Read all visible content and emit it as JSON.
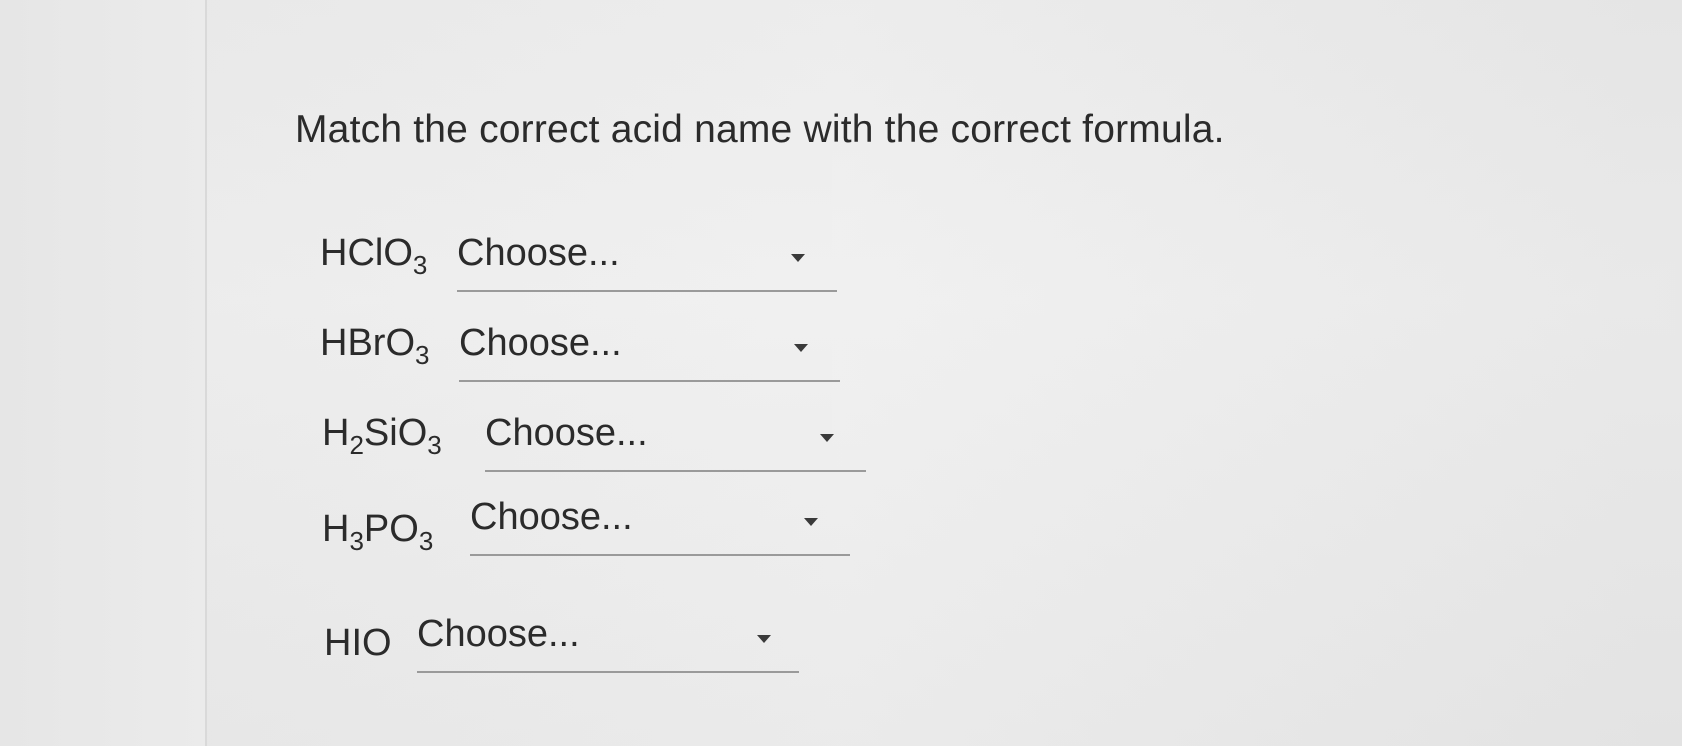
{
  "question": "Match the correct acid name with the correct formula.",
  "rows": [
    {
      "formula": {
        "parts": [
          {
            "t": "HClO"
          },
          {
            "s": "3"
          }
        ]
      },
      "select_value": "Choose..."
    },
    {
      "formula": {
        "parts": [
          {
            "t": "HBrO"
          },
          {
            "s": "3"
          }
        ]
      },
      "select_value": "Choose..."
    },
    {
      "formula": {
        "parts": [
          {
            "t": "H"
          },
          {
            "s": "2"
          },
          {
            "t": "SiO"
          },
          {
            "s": "3"
          }
        ]
      },
      "select_value": "Choose..."
    },
    {
      "formula": {
        "parts": [
          {
            "t": "H"
          },
          {
            "s": "3"
          },
          {
            "t": "PO"
          },
          {
            "s": "3"
          }
        ]
      },
      "select_value": "Choose..."
    },
    {
      "formula": {
        "parts": [
          {
            "t": "HIO"
          }
        ]
      },
      "select_value": "Choose..."
    }
  ],
  "icons": {
    "dropdown": "chevron-down-icon"
  }
}
